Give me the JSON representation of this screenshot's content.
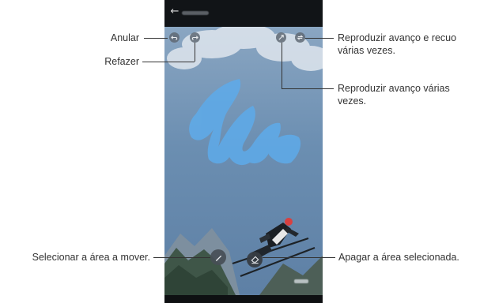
{
  "callouts": {
    "undo": "Anular",
    "redo": "Refazer",
    "play_back_forth": "Reproduzir avanço e recuo",
    "play_back_forth_2": "várias vezes.",
    "play_forward": "Reproduzir avanço várias",
    "play_forward_2": "vezes.",
    "select_area": "Selecionar a área a mover.",
    "erase_area": "Apagar a área selecionada."
  },
  "screen": {
    "icons": {
      "back": "arrow-left-icon",
      "undo": "undo-icon",
      "redo": "redo-icon",
      "play_forward": "play-forward-icon",
      "play_back_forth": "repeat-icon",
      "select": "brush-icon",
      "erase": "eraser-icon"
    }
  },
  "colors": {
    "sky": "#6d8fb0",
    "brush_overlay": "#5fa9e6",
    "bar": "#111417"
  }
}
